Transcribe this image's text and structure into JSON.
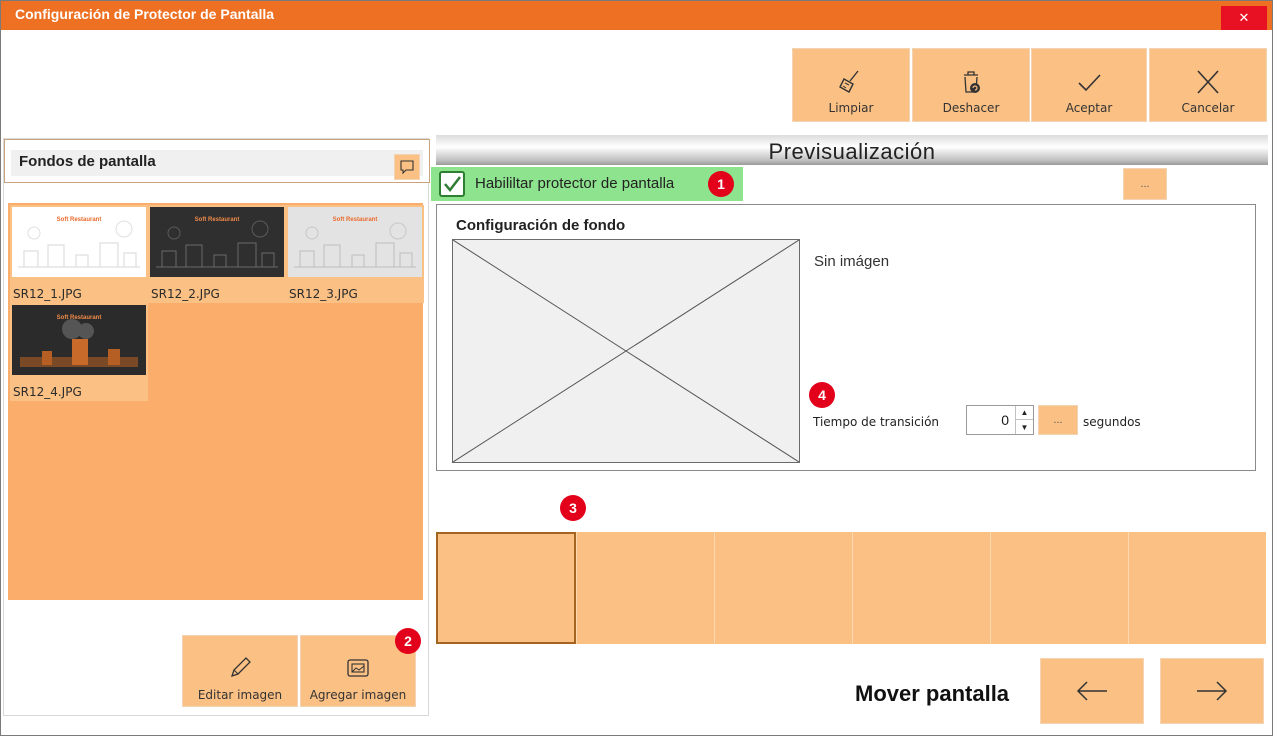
{
  "window": {
    "title": "Configuración de Protector de Pantalla",
    "close_label": "✕"
  },
  "toolbar": {
    "limpiar": "Limpiar",
    "deshacer": "Deshacer",
    "aceptar": "Aceptar",
    "cancelar": "Cancelar"
  },
  "left_panel": {
    "title": "Fondos de pantalla",
    "thumbnails": [
      {
        "name": "SR12_1.JPG",
        "brand": "Soft Restaurant",
        "theme": "light"
      },
      {
        "name": "SR12_2.JPG",
        "brand": "Soft Restaurant",
        "theme": "dark"
      },
      {
        "name": "SR12_3.JPG",
        "brand": "Soft Restaurant",
        "theme": "gray"
      },
      {
        "name": "SR12_4.JPG",
        "brand": "Soft Restaurant",
        "theme": "dark-orange"
      }
    ],
    "edit_label": "Editar imagen",
    "add_label": "Agregar imagen"
  },
  "preview": {
    "title": "Previsualización",
    "enable_label": "Habililtar protector de pantalla",
    "enabled": true,
    "dots_label": "...",
    "config_title": "Configuración de fondo",
    "no_image_label": "Sin imágen",
    "transition_label": "Tiempo de transición",
    "transition_value": "0",
    "transition_dots": "...",
    "seconds_label": "segundos"
  },
  "badges": {
    "b1": "1",
    "b2": "2",
    "b3": "3",
    "b4": "4"
  },
  "footer": {
    "mover_label": "Mover pantalla"
  },
  "colors": {
    "accent": "#ee7123",
    "button": "#fbc084",
    "gallery": "#fbad6c",
    "check_bg": "#8ee38e",
    "badge": "#e2001a"
  }
}
